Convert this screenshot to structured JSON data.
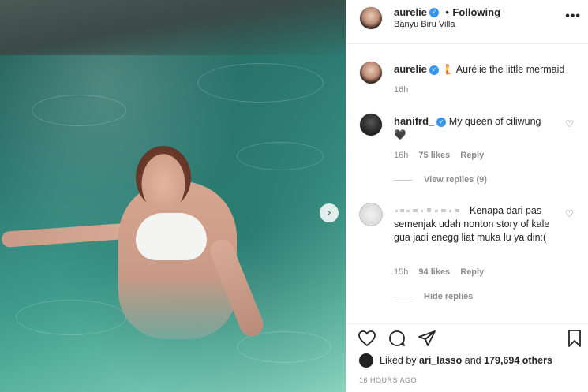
{
  "post": {
    "author": "aurelie",
    "follow_status": "Following",
    "location": "Banyu Biru Villa",
    "caption_emoji": "🧜",
    "caption": "Aurélie the little mermaid",
    "caption_time": "16h"
  },
  "comments": [
    {
      "username": "hanifrd_",
      "text": "My queen of ciliwung",
      "emoji": "🖤",
      "time": "16h",
      "likes": "75 likes",
      "reply_label": "Reply",
      "replies_toggle": "View replies (9)"
    },
    {
      "username": "",
      "text": "Kenapa dari pas semenjak udah nonton story of kale gua jadi enegg liat muka lu ya din:(",
      "time": "15h",
      "likes": "94 likes",
      "reply_label": "Reply",
      "replies_toggle": "Hide replies"
    }
  ],
  "footer": {
    "liked_by_prefix": "Liked by",
    "liked_by_user": "ari_lasso",
    "and": "and",
    "likes_count": "179,694 others",
    "time_ago": "16 HOURS AGO"
  },
  "icons": {
    "more": "more-options-icon",
    "like": "heart-icon",
    "comment": "comment-icon",
    "share": "share-icon",
    "save": "bookmark-icon",
    "next": "chevron-right-icon"
  },
  "colors": {
    "verified": "#3897f0",
    "text": "#262626",
    "muted": "#8e8e8e"
  }
}
